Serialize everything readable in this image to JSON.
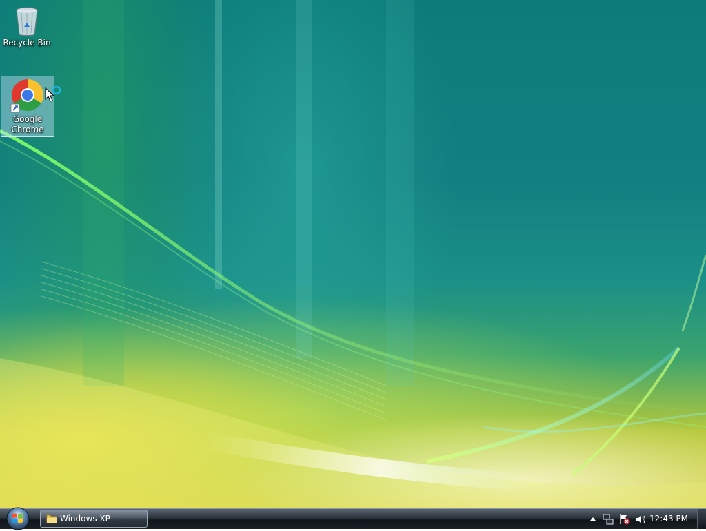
{
  "desktop": {
    "icons": [
      {
        "label": "Recycle Bin",
        "icon": "recycle-bin-icon"
      },
      {
        "label": "Google Chrome",
        "icon": "chrome-icon",
        "selected": true
      }
    ]
  },
  "taskbar": {
    "start": {
      "icon": "windows-start-orb-icon"
    },
    "tasks": [
      {
        "label": "Windows XP",
        "icon": "folder-icon"
      }
    ],
    "tray": {
      "icons": [
        "show-hidden-icons-arrow",
        "network-icon",
        "action-center-flag-icon",
        "speaker-icon"
      ],
      "clock": "12:43 PM"
    }
  },
  "colors": {
    "wallpaper_teal": "#127f80",
    "wallpaper_yellow": "#d7d13f",
    "taskbar_dark": "#10151a",
    "selection": "#bedcf5"
  }
}
